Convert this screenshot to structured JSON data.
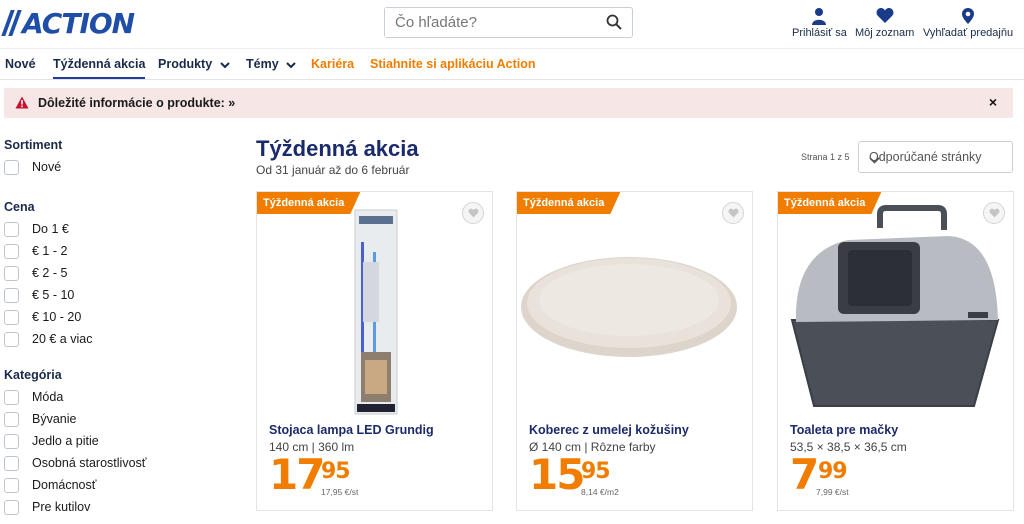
{
  "header": {
    "logo_text": "ACTION",
    "search_placeholder": "Čo hľadáte?",
    "links": {
      "login": "Prihlásiť sa",
      "list": "Môj zoznam",
      "store": "Vyhľadať predajňu"
    }
  },
  "nav": {
    "items": [
      {
        "label": "Nové"
      },
      {
        "label": "Týždenná akcia"
      },
      {
        "label": "Produkty"
      },
      {
        "label": "Témy"
      },
      {
        "label": "Kariéra"
      },
      {
        "label": "Stiahnite si aplikáciu Action"
      }
    ]
  },
  "alert": {
    "text": "Dôležité informácie o produkte: »",
    "close": "×"
  },
  "sidebar": {
    "sortiment": {
      "title": "Sortiment",
      "options": [
        "Nové"
      ]
    },
    "cena": {
      "title": "Cena",
      "options": [
        "Do 1 €",
        "€ 1 - 2",
        "€ 2 - 5",
        "€ 5 - 10",
        "€ 10 - 20",
        "20 € a viac"
      ]
    },
    "kategoria": {
      "title": "Kategória",
      "options": [
        "Móda",
        "Bývanie",
        "Jedlo a pitie",
        "Osobná starostlivosť",
        "Domácnosť",
        "Pre kutilov"
      ]
    }
  },
  "main": {
    "title": "Týždenná akcia",
    "subtitle": "Od 31 január až do 6 február",
    "pager": "Strana 1 z 5",
    "sort_value": "Odporúčané stránky"
  },
  "products": [
    {
      "badge": "Týždenná akcia",
      "name": "Stojaca lampa LED Grundig",
      "desc": "140 cm | 360 lm",
      "price_int": "17",
      "price_dec": "95",
      "unit_price": "17,95 €/st"
    },
    {
      "badge": "Týždenná akcia",
      "name": "Koberec z umelej kožušiny",
      "desc": "Ø 140 cm | Rôzne farby",
      "price_int": "15",
      "price_dec": "95",
      "unit_price": "8,14 €/m2"
    },
    {
      "badge": "Týždenná akcia",
      "name": "Toaleta pre mačky",
      "desc": "53,5 × 38,5 × 36,5 cm",
      "price_int": "7",
      "price_dec": "99",
      "unit_price": "7,99 €/st"
    }
  ],
  "colors": {
    "brand_blue": "#1f4ea8",
    "accent_orange": "#f07d00",
    "alert_bg": "#f6e6e6",
    "alert_icon": "#c8102e"
  },
  "icons": [
    "search-icon",
    "user-icon",
    "heart-icon",
    "location-pin-icon",
    "chevron-down-icon",
    "warning-icon",
    "close-icon"
  ]
}
